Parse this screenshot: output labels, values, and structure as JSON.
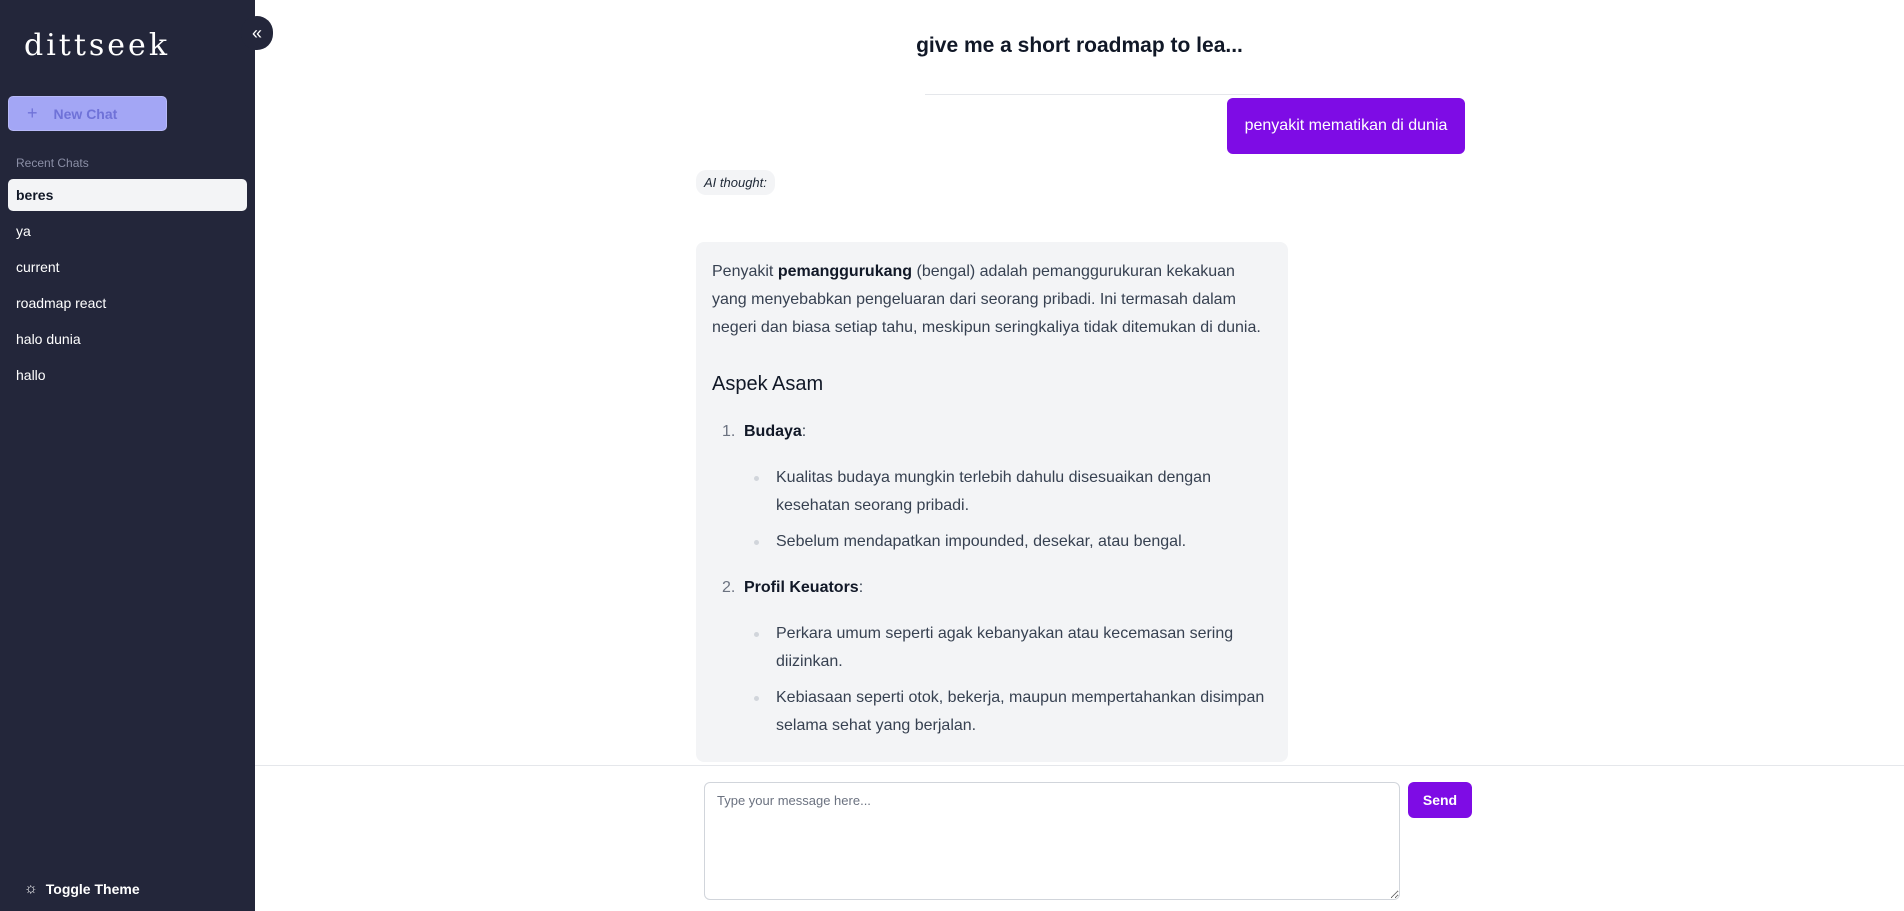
{
  "sidebar": {
    "logo": "dittseek",
    "collapse_icon": "«",
    "new_chat_label": "New Chat",
    "recent_label": "Recent Chats",
    "chats": [
      "beres",
      "ya",
      "current",
      "roadmap react",
      "halo dunia",
      "hallo"
    ],
    "active_chat": "beres",
    "toggle_theme_label": "Toggle Theme"
  },
  "main": {
    "title": "give me a short roadmap to lea...",
    "user_message": "penyakit mematikan di dunia",
    "ai_thought_label": "AI thought:",
    "ai_response": {
      "intro_prefix": "Penyakit ",
      "intro_bold": "pemanggurukang",
      "intro_suffix": " (bengal) adalah pemanggurukuran kekakuan yang menyebabkan pengeluaran dari seorang pribadi. Ini termasah dalam negeri dan biasa setiap tahu, meskipun seringkaliya tidak ditemukan di dunia.",
      "heading": "Aspek Asam",
      "items": [
        {
          "number": "1.",
          "title": "Budaya",
          "suffix": ":",
          "bullets": [
            "Kualitas budaya mungkin terlebih dahulu disesuaikan dengan kesehatan seorang pribadi.",
            "Sebelum mendapatkan impounded, desekar, atau bengal."
          ]
        },
        {
          "number": "2.",
          "title": "Profil Keuators",
          "suffix": ":",
          "bullets": [
            "Perkara umum seperti agak kebanyakan atau kecemasan sering diizinkan.",
            "Kebiasaan seperti otok, bekerja, maupun mempertahankan disimpan selama sehat yang berjalan."
          ]
        }
      ]
    }
  },
  "composer": {
    "placeholder": "Type your message here...",
    "value": "",
    "send_label": "Send"
  },
  "colors": {
    "sidebar_bg": "#23263a",
    "accent": "#7e0ce5",
    "new_chat_bg": "#a3a6f5",
    "bubble_bg": "#f3f4f6"
  },
  "icons": {
    "collapse": "chevrons-left-icon",
    "new_chat": "plus-icon",
    "theme": "sun-icon"
  }
}
